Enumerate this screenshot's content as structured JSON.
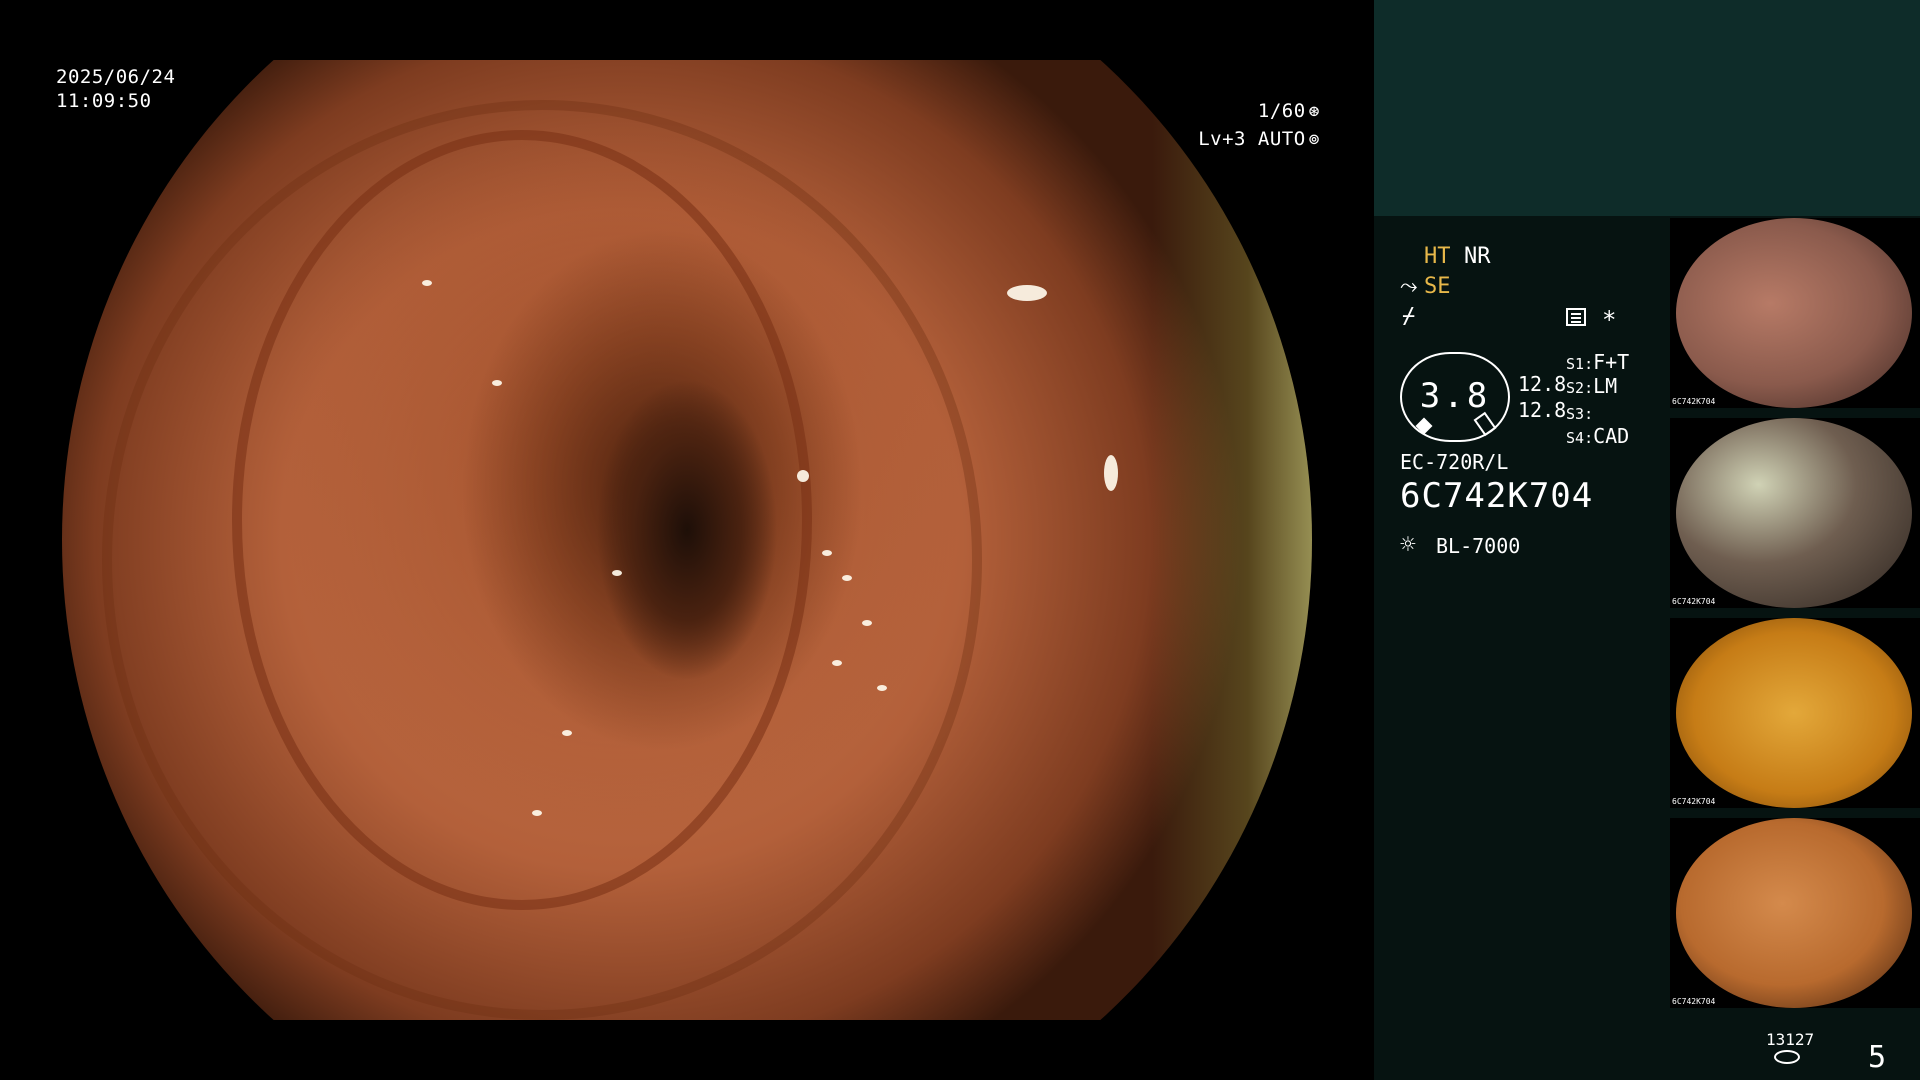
{
  "overlay": {
    "date": "2025/06/24",
    "time": "11:09:50",
    "shutter": "1/60",
    "level": "Lv+3 AUTO"
  },
  "processor": {
    "ht": "HT",
    "nr": "NR",
    "se": "SE",
    "gauge_value": "3.8",
    "gauge_side_1": "12.8",
    "gauge_side_2": "12.8",
    "switches": [
      {
        "key": "S1",
        "value": "F+T"
      },
      {
        "key": "S2",
        "value": "LM"
      },
      {
        "key": "S3",
        "value": ""
      },
      {
        "key": "S4",
        "value": "CAD"
      }
    ],
    "scope_model": "EC-720R/L",
    "scope_serial": "6C742K704",
    "light_source": "BL-7000"
  },
  "thumbnails": [
    {
      "label": "6C742K704"
    },
    {
      "label": "6C742K704"
    },
    {
      "label": "6C742K704"
    },
    {
      "label": "6C742K704"
    }
  ],
  "footer": {
    "image_count": "13127",
    "page": "5"
  },
  "icons": {
    "shutter": "aperture-icon",
    "level": "iris-icon",
    "se": "structure-enhance-icon",
    "menu": "menu-list-icon",
    "star": "asterisk-icon",
    "light": "light-source-icon",
    "storage": "storage-disk-icon"
  },
  "colors": {
    "panel_top": "#0e2c29",
    "panel_side": "#061311",
    "accent_amber": "#e8b84a"
  }
}
